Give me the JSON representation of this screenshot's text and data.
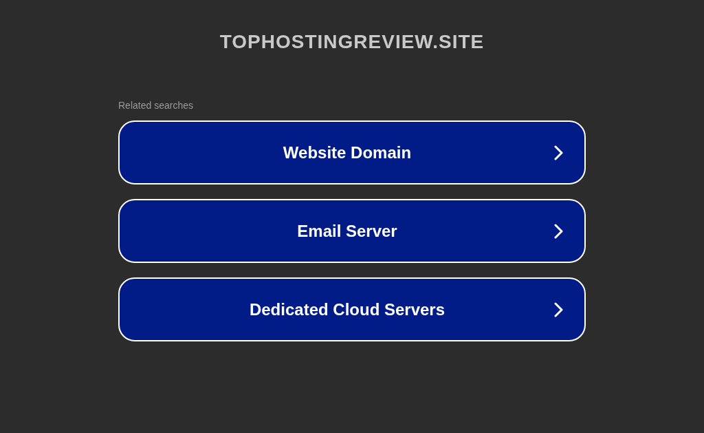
{
  "site_title": "TOPHOSTINGREVIEW.SITE",
  "related": {
    "heading": "Related searches",
    "links": [
      {
        "label": "Website Domain"
      },
      {
        "label": "Email Server"
      },
      {
        "label": "Dedicated Cloud Servers"
      }
    ]
  }
}
